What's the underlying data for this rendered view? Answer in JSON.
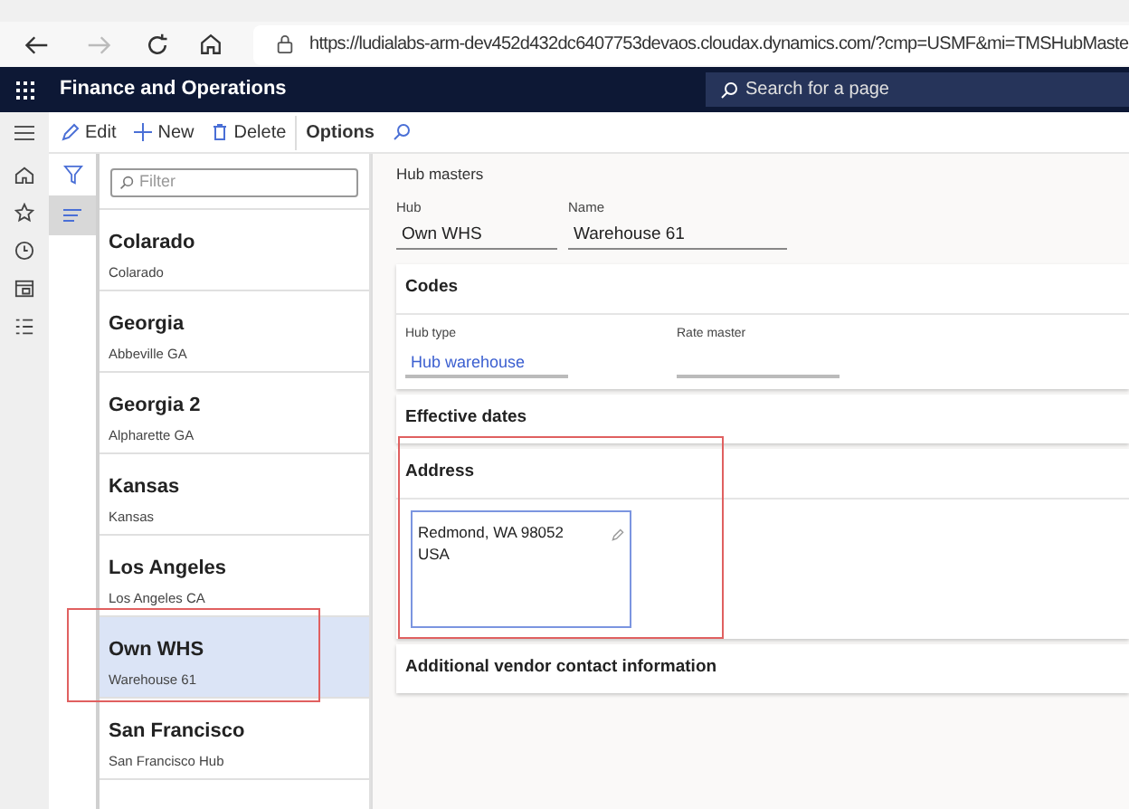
{
  "browser": {
    "url": "https://ludialabs-arm-dev452d432dc6407753devaos.cloudax.dynamics.com/?cmp=USMF&mi=TMSHubMaste"
  },
  "app": {
    "title": "Finance and Operations",
    "search": {
      "placeholder": "Search for a page"
    }
  },
  "actions": [
    {
      "kind": "edit",
      "label": "Edit"
    },
    {
      "kind": "new",
      "label": "New"
    },
    {
      "kind": "delete",
      "label": "Delete"
    },
    {
      "kind": "options",
      "label": "Options"
    },
    {
      "kind": "find"
    }
  ],
  "filter": {
    "placeholder": "Filter"
  },
  "list": [
    {
      "title": "Colarado",
      "subtitle": "Colarado",
      "selected": false
    },
    {
      "title": "Georgia",
      "subtitle": "Abbeville GA",
      "selected": false
    },
    {
      "title": "Georgia 2",
      "subtitle": "Alpharette GA",
      "selected": false
    },
    {
      "title": "Kansas",
      "subtitle": "Kansas",
      "selected": false
    },
    {
      "title": "Los Angeles",
      "subtitle": "Los Angeles CA",
      "selected": false
    },
    {
      "title": "Own WHS",
      "subtitle": "Warehouse 61",
      "selected": true
    },
    {
      "title": "San Francisco",
      "subtitle": "San Francisco Hub",
      "selected": false
    }
  ],
  "form": {
    "caption": "Hub masters",
    "fields": [
      {
        "label": "Hub",
        "value": "Own WHS"
      },
      {
        "label": "Name",
        "value": "Warehouse 61"
      }
    ]
  },
  "sections": [
    {
      "kind": "fields",
      "title": "Codes",
      "fields": [
        {
          "label": "Hub type",
          "value": "Hub warehouse"
        },
        {
          "label": "Rate master"
        }
      ]
    },
    {
      "kind": "collapsed",
      "title": "Effective dates"
    },
    {
      "kind": "address",
      "title": "Address",
      "lines": [
        "Redmond, WA 98052",
        "USA"
      ]
    },
    {
      "kind": "collapsed",
      "title": "Additional vendor contact information"
    }
  ]
}
